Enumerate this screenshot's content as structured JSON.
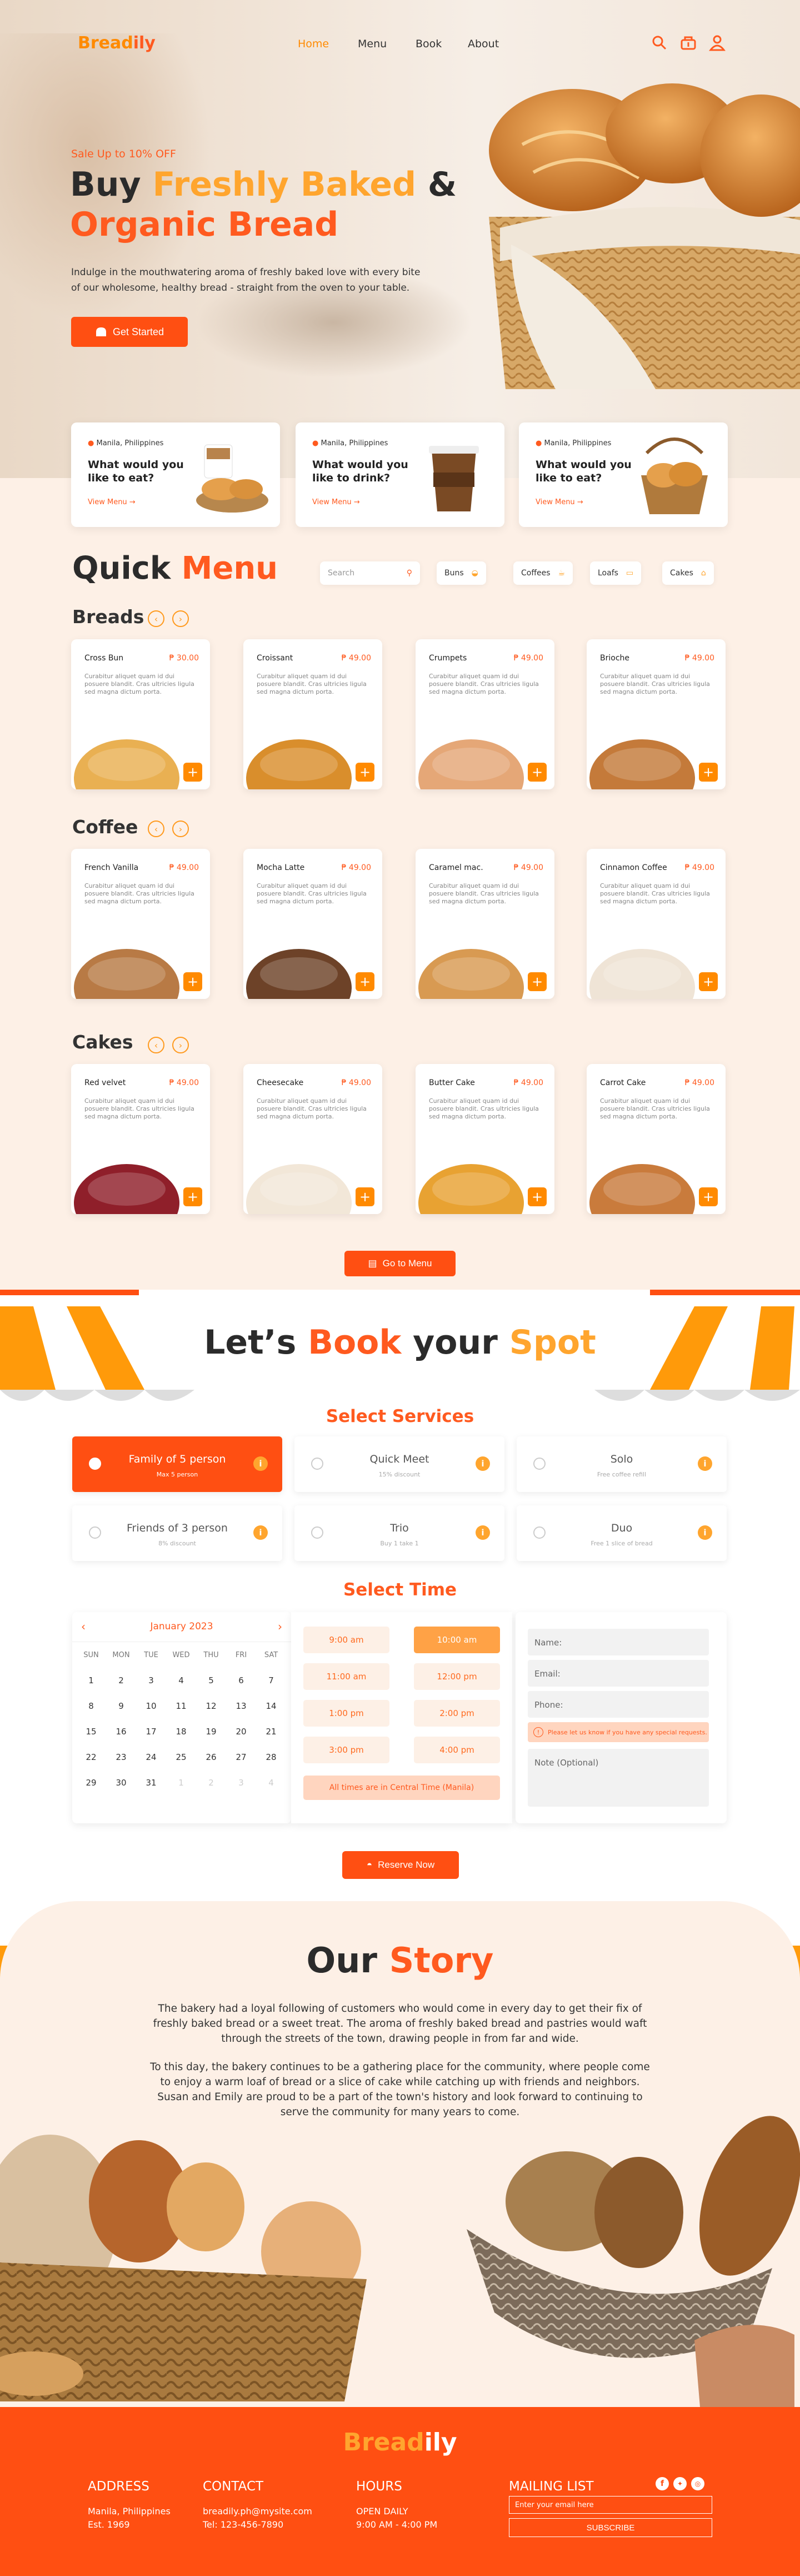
{
  "header": {
    "logo_a": "Bread",
    "logo_b": "ily",
    "nav": [
      "Home",
      "Menu",
      "Book",
      "About"
    ]
  },
  "hero": {
    "kicker": "Sale Up to 10% OFF",
    "title_a": "Buy ",
    "title_b": "Freshly Baked",
    "title_c": " &",
    "title_d": "Organic Bread",
    "text_1": "Indulge in the mouthwatering aroma of freshly baked love with every bite",
    "text_2": "of our wholesome, healthy bread - straight from the oven to your table.",
    "cta": "Get Started"
  },
  "promos": [
    {
      "location": "Manila, Philippines",
      "q1": "What would you",
      "q2": "like to eat?",
      "link": "View Menu"
    },
    {
      "location": "Manila, Philippines",
      "q1": "What would you",
      "q2": "like to drink?",
      "link": "View Menu"
    },
    {
      "location": "Manila, Philippines",
      "q1": "What would you",
      "q2": "like to eat?",
      "link": "View Menu"
    }
  ],
  "menu": {
    "title_a": "Quick ",
    "title_b": "Menu",
    "search_placeholder": "Search",
    "filters": [
      "Buns",
      "Coffees",
      "Loafs",
      "Cakes"
    ],
    "desc": "Curabitur aliquet quam id dui posuere blandit. Cras ultricies ligula sed magna dictum porta.",
    "categories": [
      {
        "name": "Breads",
        "items": [
          {
            "name": "Cross Bun",
            "price": "₱ 30.00"
          },
          {
            "name": "Croissant",
            "price": "₱ 49.00"
          },
          {
            "name": "Crumpets",
            "price": "₱ 49.00"
          },
          {
            "name": "Brioche",
            "price": "₱ 49.00"
          }
        ]
      },
      {
        "name": "Coffee",
        "items": [
          {
            "name": "French Vanilla",
            "price": "₱ 49.00"
          },
          {
            "name": "Mocha Latte",
            "price": "₱ 49.00"
          },
          {
            "name": "Caramel mac.",
            "price": "₱ 49.00"
          },
          {
            "name": "Cinnamon Coffee",
            "price": "₱ 49.00"
          }
        ]
      },
      {
        "name": "Cakes",
        "items": [
          {
            "name": "Red velvet",
            "price": "₱ 49.00"
          },
          {
            "name": "Cheesecake",
            "price": "₱ 49.00"
          },
          {
            "name": "Butter Cake",
            "price": "₱ 49.00"
          },
          {
            "name": "Carrot Cake",
            "price": "₱ 49.00"
          }
        ]
      }
    ],
    "go_button": "Go to Menu"
  },
  "booking": {
    "title_a": "Let’s ",
    "title_b": "Book",
    "title_c": " your ",
    "title_d": "Spot",
    "services_title": "Select Services",
    "services": [
      {
        "name": "Family of 5 person",
        "sub": "Max 5 person",
        "active": true
      },
      {
        "name": "Quick Meet",
        "sub": "15% discount",
        "active": false
      },
      {
        "name": "Solo",
        "sub": "Free coffee refill",
        "active": false
      },
      {
        "name": "Friends of 3 person",
        "sub": "8% discount",
        "active": false
      },
      {
        "name": "Trio",
        "sub": "Buy 1 take 1",
        "active": false
      },
      {
        "name": "Duo",
        "sub": "Free 1 slice of bread",
        "active": false
      }
    ],
    "time_title": "Select Time",
    "calendar": {
      "month": "January 2023",
      "dow": [
        "SUN",
        "MON",
        "TUE",
        "WED",
        "THU",
        "FRI",
        "SAT"
      ],
      "weeks": [
        [
          "1",
          "2",
          "3",
          "4",
          "5",
          "6",
          "7"
        ],
        [
          "8",
          "9",
          "10",
          "11",
          "12",
          "13",
          "14"
        ],
        [
          "15",
          "16",
          "17",
          "18",
          "19",
          "20",
          "21"
        ],
        [
          "22",
          "23",
          "24",
          "25",
          "26",
          "27",
          "28"
        ],
        [
          "29",
          "30",
          "31",
          "1",
          "2",
          "3",
          "4"
        ]
      ]
    },
    "slots": [
      "9:00 am",
      "10:00 am",
      "11:00 am",
      "12:00 pm",
      "1:00 pm",
      "2:00 pm",
      "3:00 pm",
      "4:00 pm"
    ],
    "selected_slot": "10:00 am",
    "timezone_note": "All times are in Central Time (Manila)",
    "form": {
      "name": "Name:",
      "email": "Email:",
      "phone": "Phone:",
      "notice": "Please let us know if you have any special requests.",
      "note": "Note (Optional)"
    },
    "reserve": "Reserve Now"
  },
  "story": {
    "title_a": "Our ",
    "title_b": "Story",
    "p1_l1": "The bakery had a loyal following of customers who would come in every day to get their fix of",
    "p1_l2": "freshly baked bread or a sweet treat. The aroma of freshly baked bread and pastries would waft",
    "p1_l3": "through the streets of the town, drawing people in from far and wide.",
    "p2_l1": "To this day, the bakery continues to be a gathering place for the community, where people come",
    "p2_l2": "to enjoy a warm loaf of bread or a slice of cake while catching up with friends and neighbors.",
    "p2_l3": "Susan and Emily are proud to be a part of the town's history and look forward to continuing to",
    "p2_l4": "serve the community for many years to come."
  },
  "footer": {
    "logo_a": "Bread",
    "logo_b": "ily",
    "address_h": "ADDRESS",
    "address_1": "Manila, Philippines",
    "address_2": "Est. 1969",
    "contact_h": "CONTACT",
    "contact_1": "breadily.ph@mysite.com",
    "contact_2": "Tel: 123-456-7890",
    "hours_h": "HOURS",
    "hours_1": "OPEN DAILY",
    "hours_2": "9:00 AM - 4:00 PM",
    "mail_h": "MAILING LIST",
    "mail_placeholder": "Enter your email here",
    "subscribe": "SUBSCRIBE"
  },
  "colors": {
    "accent": "#ff5a1f",
    "accent_light": "#ffa52e",
    "cream": "#fdf0e6"
  }
}
